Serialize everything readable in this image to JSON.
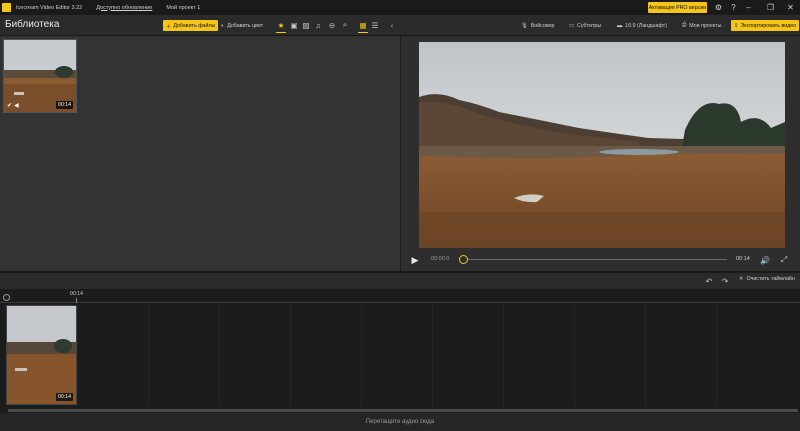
{
  "titlebar": {
    "app_title": "Icecream Video Editor 3.22",
    "update_link": "Доступно обновление",
    "project_name": "Мой проект 1",
    "pro_button": "Активация PRO версии"
  },
  "toolbar": {
    "library_title": "Библиотека",
    "add_files": "Добавить файлы",
    "add_color": "Добавить цвет",
    "voiceover": "Войсовер",
    "subtitles": "Субтитры",
    "aspect_ratio": "16:9 (Ландшафт)",
    "my_projects": "Мои проекты",
    "export_video": "Экспортировать видео"
  },
  "library": {
    "items": [
      {
        "duration": "00:14"
      }
    ]
  },
  "player": {
    "current_time": "00:00.0",
    "total_time": "00:14",
    "progress": 0.0
  },
  "timeline": {
    "clear_label": "Очистить таймлайн",
    "ruler_label": "00:14",
    "clips": [
      {
        "duration": "00:14"
      }
    ],
    "audio_drop_text": "Перетащите аудио сюда"
  },
  "colors": {
    "accent": "#f5c518",
    "panel": "#333333",
    "timeline_bg": "#1c1c1c"
  }
}
